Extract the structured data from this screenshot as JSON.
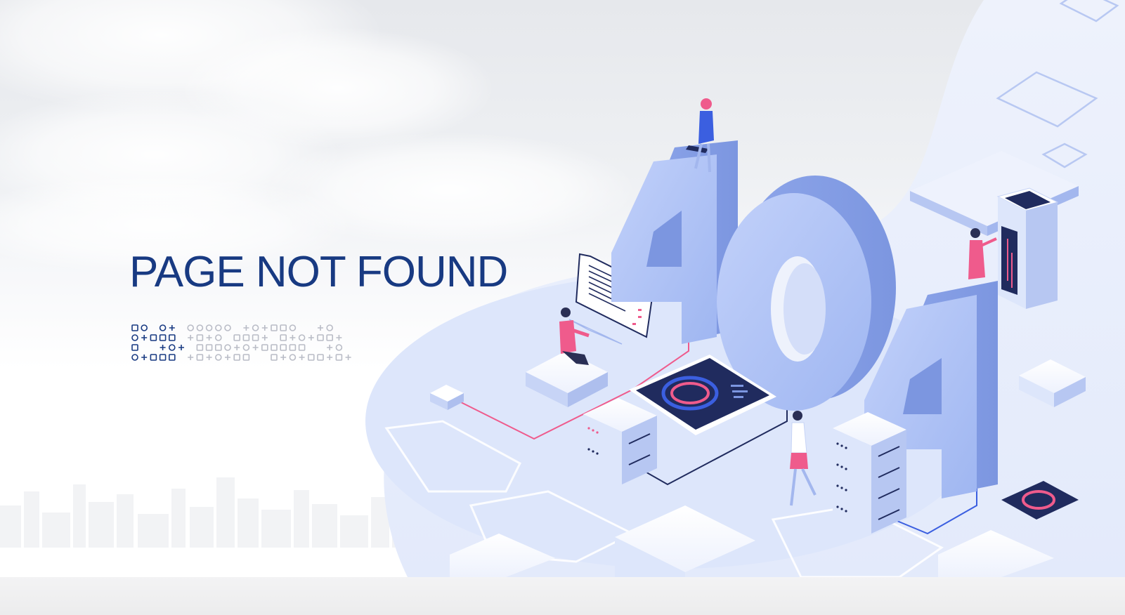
{
  "page": {
    "headline": "PAGE NOT FOUND",
    "illustration_text": "404"
  },
  "colors": {
    "headline": "#183a82",
    "digits": "#a8bdf5",
    "accent_pink": "#ef5b8c",
    "accent_navy": "#202b5e",
    "platform": "#dde6fb"
  },
  "icons": [
    "decorative-symbol-row",
    "woman-with-laptop-figure",
    "man-at-screen-figure",
    "woman-walking-figure",
    "woman-at-tower-figure",
    "server-rack-icon",
    "monitor-panel-icon",
    "target-dial-icon"
  ]
}
